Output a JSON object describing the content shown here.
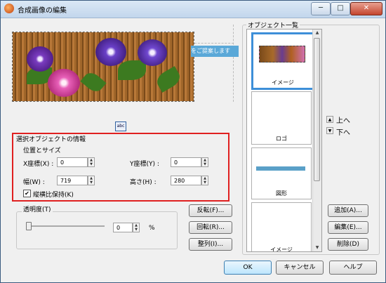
{
  "window": {
    "title": "合成画像の編集",
    "minimize_glyph": "─",
    "maximize_glyph": "□",
    "close_glyph": "✕"
  },
  "preview": {
    "tooltip": "をご提案します",
    "small_button_label": "abc"
  },
  "selected_object": {
    "group_title": "選択オブジェクトの情報",
    "position_size_title": "位置とサイズ",
    "x_label": "X座標(X) :",
    "x_value": "0",
    "y_label": "Y座標(Y) :",
    "y_value": "0",
    "width_label": "幅(W) :",
    "width_value": "719",
    "height_label": "高さ(H) :",
    "height_value": "280",
    "keep_ratio_label": "縦横比保持(K)",
    "keep_ratio_checked": true
  },
  "transparency": {
    "label": "透明度(T)",
    "value": "0",
    "unit": "%",
    "level": 0
  },
  "transform_buttons": {
    "flip": "反転(F)...",
    "rotate": "回転(R)...",
    "align": "整列(I)..."
  },
  "object_list": {
    "title": "オブジェクト一覧",
    "items": [
      {
        "label": "イメージ",
        "selected": true
      },
      {
        "label": "ロゴ",
        "selected": false
      },
      {
        "label": "図形",
        "selected": false
      },
      {
        "label": "イメージ",
        "selected": false
      }
    ],
    "order_up": "上へ",
    "order_down": "下へ",
    "add": "追加(A)...",
    "edit": "編集(E)...",
    "delete": "削除(D)"
  },
  "footer": {
    "ok": "OK",
    "cancel": "キャンセル",
    "help": "ヘルプ"
  },
  "colors": {
    "highlight_red": "#e02020",
    "list_selection": "#3d8fd8",
    "shape_bar": "#5aa0c8"
  }
}
